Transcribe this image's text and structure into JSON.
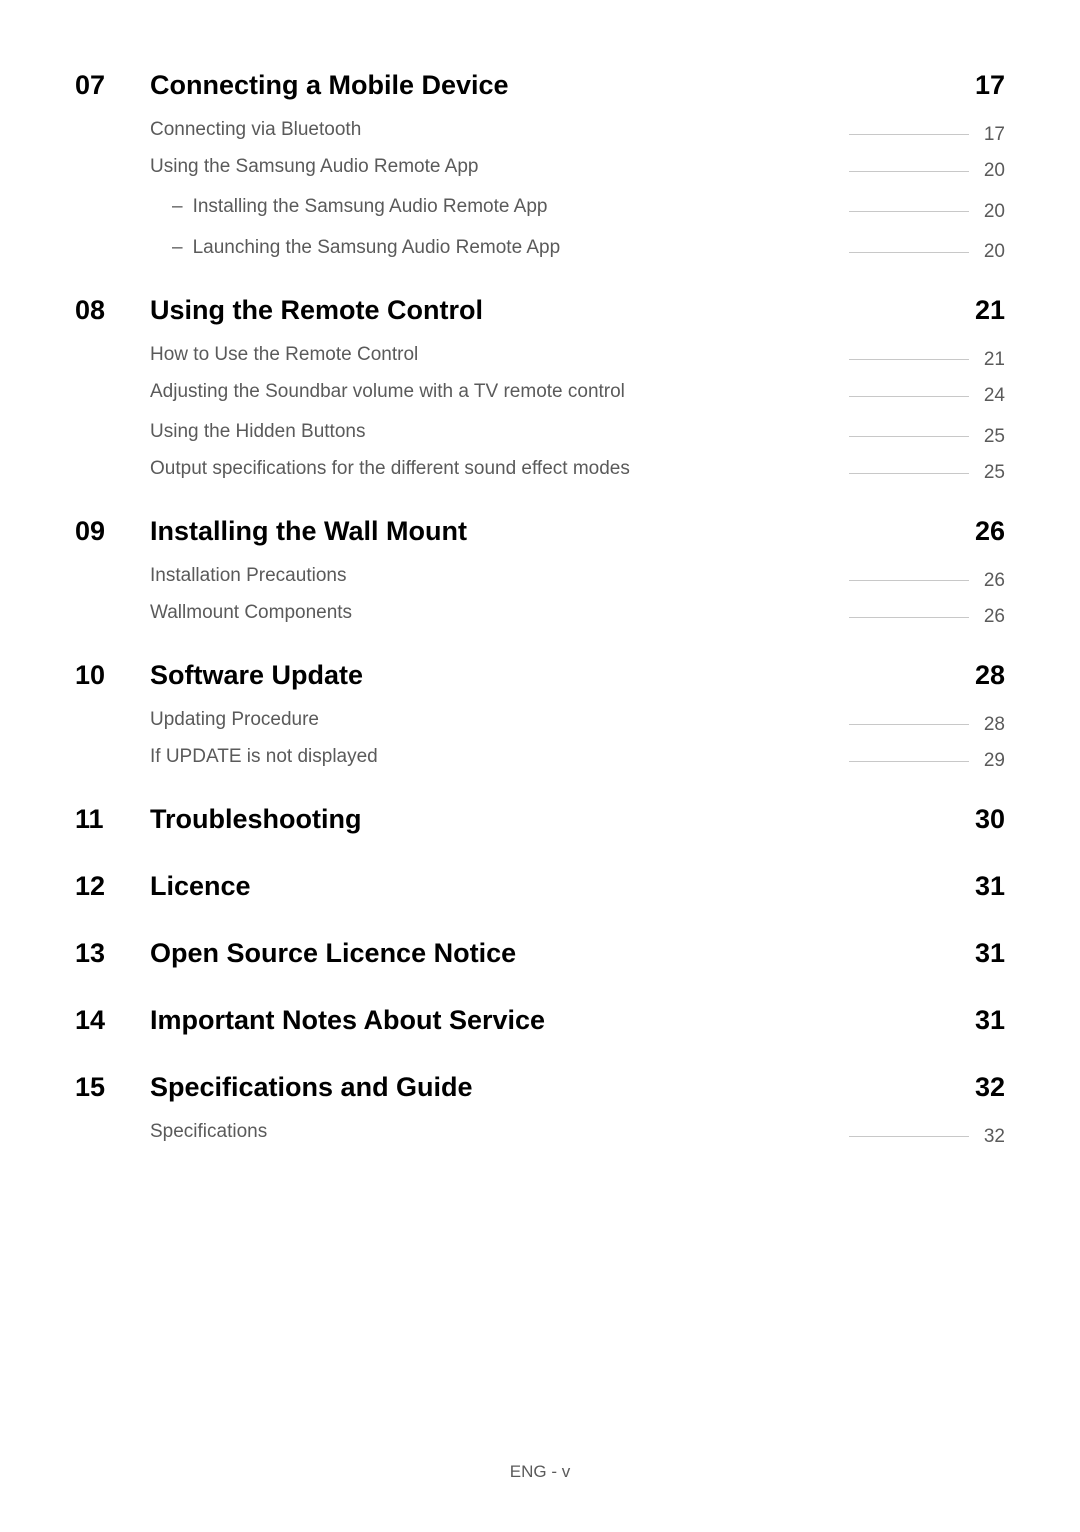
{
  "sections": [
    {
      "num": "07",
      "title": "Connecting a Mobile Device",
      "page": "17",
      "items": [
        {
          "text": "Connecting via Bluetooth",
          "page": "17",
          "group_end": true
        },
        {
          "text": "Using the Samsung Audio Remote App",
          "page": "20",
          "children": [
            {
              "text": "Installing the Samsung Audio Remote App",
              "page": "20"
            },
            {
              "text": "Launching the Samsung Audio Remote App",
              "page": "20"
            }
          ]
        }
      ]
    },
    {
      "num": "08",
      "title": "Using the Remote Control",
      "page": "21",
      "items": [
        {
          "text": "How to Use the Remote Control",
          "page": "21",
          "group_end": true
        },
        {
          "text": "Adjusting the Soundbar volume with a TV remote control",
          "page": "24"
        },
        {
          "text": "Using the Hidden Buttons",
          "page": "25",
          "group_end": true
        },
        {
          "text": "Output specifications for the different sound effect modes",
          "page": "25"
        }
      ]
    },
    {
      "num": "09",
      "title": "Installing the Wall Mount",
      "page": "26",
      "items": [
        {
          "text": "Installation Precautions",
          "page": "26",
          "group_end": true
        },
        {
          "text": "Wallmount Components",
          "page": "26"
        }
      ]
    },
    {
      "num": "10",
      "title": "Software Update",
      "page": "28",
      "items": [
        {
          "text": "Updating Procedure",
          "page": "28",
          "group_end": true
        },
        {
          "text": "If UPDATE is not displayed",
          "page": "29"
        }
      ]
    },
    {
      "num": "11",
      "title": "Troubleshooting",
      "page": "30",
      "items": []
    },
    {
      "num": "12",
      "title": "Licence",
      "page": "31",
      "items": []
    },
    {
      "num": "13",
      "title": "Open Source Licence Notice",
      "page": "31",
      "items": []
    },
    {
      "num": "14",
      "title": "Important Notes About Service",
      "page": "31",
      "items": []
    },
    {
      "num": "15",
      "title": "Specifications and Guide",
      "page": "32",
      "items": [
        {
          "text": "Specifications",
          "page": "32"
        }
      ]
    }
  ],
  "footer": "ENG - v"
}
